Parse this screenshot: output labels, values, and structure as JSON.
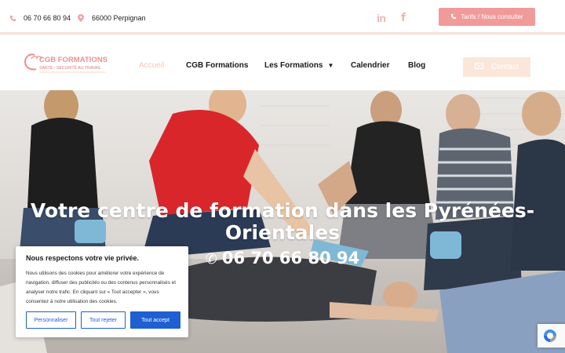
{
  "topbar": {
    "phone": "06 70 66 80 94",
    "location": "66000 Perpignan",
    "social": {
      "linkedin": "in",
      "facebook": "f"
    },
    "cta_label": "Tarifs / Nous consulter"
  },
  "brand": {
    "logo_title": "CGB FORMATIONS",
    "logo_subtitle": "SANTÉ · SÉCURITÉ AU TRAVAIL"
  },
  "nav": {
    "items": [
      {
        "label": "Accueil",
        "active": true
      },
      {
        "label": "CGB Formations"
      },
      {
        "label": "Les Formations",
        "dropdown": true
      },
      {
        "label": "Calendrier"
      },
      {
        "label": "Blog"
      }
    ],
    "contact_label": "Contact"
  },
  "hero": {
    "title": "Votre centre de formation dans les Pyrénées-Orientales",
    "phone_icon": "✆",
    "phone": "06 70 66 80 94"
  },
  "cookie": {
    "title": "Nous respectons votre vie privée.",
    "text": "Nous utilisons des cookies pour améliorer votre expérience de navigation, diffuser des publicités ou des contenus personnalisés et analyser notre trafic. En cliquant sur « Tout accepter », vous consentez à notre utilisation des cookies.",
    "buttons": {
      "customize": "Personnaliser",
      "reject": "Tout rejeter",
      "accept": "Tout accept"
    }
  },
  "colors": {
    "accent": "#f19a9a",
    "accent_light": "#fbe7d9",
    "nav_active": "#f5c6b0",
    "cookie_blue": "#1f5fd1"
  },
  "icons": {
    "phone": "phone-icon",
    "location": "location-pin-icon",
    "linkedin": "linkedin-icon",
    "facebook": "facebook-icon",
    "email": "envelope-icon",
    "recaptcha": "recaptcha-icon"
  }
}
